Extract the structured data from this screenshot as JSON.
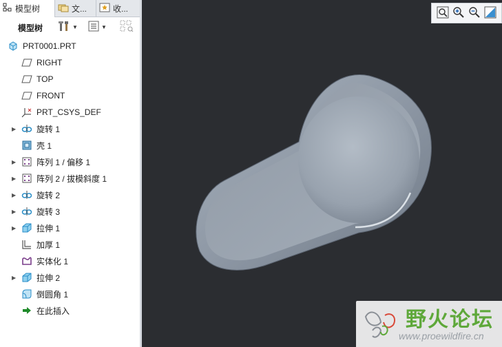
{
  "tabs": [
    {
      "label": "模型树",
      "icon": "model-tree-icon"
    },
    {
      "label": "文...",
      "icon": "folder-browser-icon"
    },
    {
      "label": "收...",
      "icon": "favorites-icon"
    }
  ],
  "toolbar": {
    "label": "模型树",
    "settings_icon": "tools-icon",
    "show_icon": "list-icon",
    "filter_icon": "filter-icon"
  },
  "tree": {
    "root": "PRT0001.PRT",
    "items": [
      {
        "label": "RIGHT",
        "icon": "datum-plane-icon",
        "expandable": false
      },
      {
        "label": "TOP",
        "icon": "datum-plane-icon",
        "expandable": false
      },
      {
        "label": "FRONT",
        "icon": "datum-plane-icon",
        "expandable": false
      },
      {
        "label": "PRT_CSYS_DEF",
        "icon": "coordinate-system-icon",
        "expandable": false
      },
      {
        "label": "旋转 1",
        "icon": "revolve-icon",
        "expandable": true
      },
      {
        "label": "壳 1",
        "icon": "shell-icon",
        "expandable": false
      },
      {
        "label": "阵列 1 / 偏移 1",
        "icon": "pattern-icon",
        "expandable": true
      },
      {
        "label": "阵列 2 / 拔模斜度 1",
        "icon": "pattern-icon",
        "expandable": true
      },
      {
        "label": "旋转 2",
        "icon": "revolve-icon",
        "expandable": true
      },
      {
        "label": "旋转 3",
        "icon": "revolve-icon",
        "expandable": true
      },
      {
        "label": "拉伸 1",
        "icon": "extrude-icon",
        "expandable": true
      },
      {
        "label": "加厚 1",
        "icon": "thicken-icon",
        "expandable": false
      },
      {
        "label": "实体化 1",
        "icon": "solidify-icon",
        "expandable": false
      },
      {
        "label": "拉伸 2",
        "icon": "extrude-icon",
        "expandable": true
      },
      {
        "label": "倒圆角 1",
        "icon": "round-icon",
        "expandable": false
      },
      {
        "label": "在此插入",
        "icon": "insert-here-arrow-icon",
        "expandable": false
      }
    ]
  },
  "view_toolbar": [
    "refit-icon",
    "zoom-in-icon",
    "zoom-out-icon",
    "saved-views-icon"
  ],
  "watermark": {
    "title": "野火论坛",
    "url": "www.proewildfire.cn"
  },
  "colors": {
    "viewport_bg": "#2b2d31",
    "model": "#8c96a3",
    "watermark_green": "#5ea83a"
  }
}
